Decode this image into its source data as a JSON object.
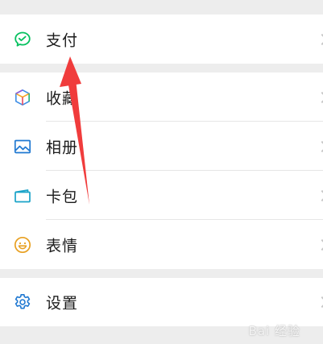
{
  "menu": {
    "pay": {
      "label": "支付",
      "icon": "pay-icon"
    },
    "favorites": {
      "label": "收藏",
      "icon": "favorites-cube-icon"
    },
    "album": {
      "label": "相册",
      "icon": "album-image-icon"
    },
    "cards": {
      "label": "卡包",
      "icon": "card-wallet-icon"
    },
    "stickers": {
      "label": "表情",
      "icon": "smiley-face-icon"
    },
    "settings": {
      "label": "设置",
      "icon": "gear-icon"
    }
  },
  "watermark": {
    "text": "Bai 经验"
  },
  "colors": {
    "pay_green": "#07c160",
    "album_blue": "#1f78d1",
    "card_teal": "#1aa3c8",
    "sticker_yellow": "#e8a021",
    "settings_blue": "#1f78d1",
    "arrow_red": "#f03c3c"
  }
}
